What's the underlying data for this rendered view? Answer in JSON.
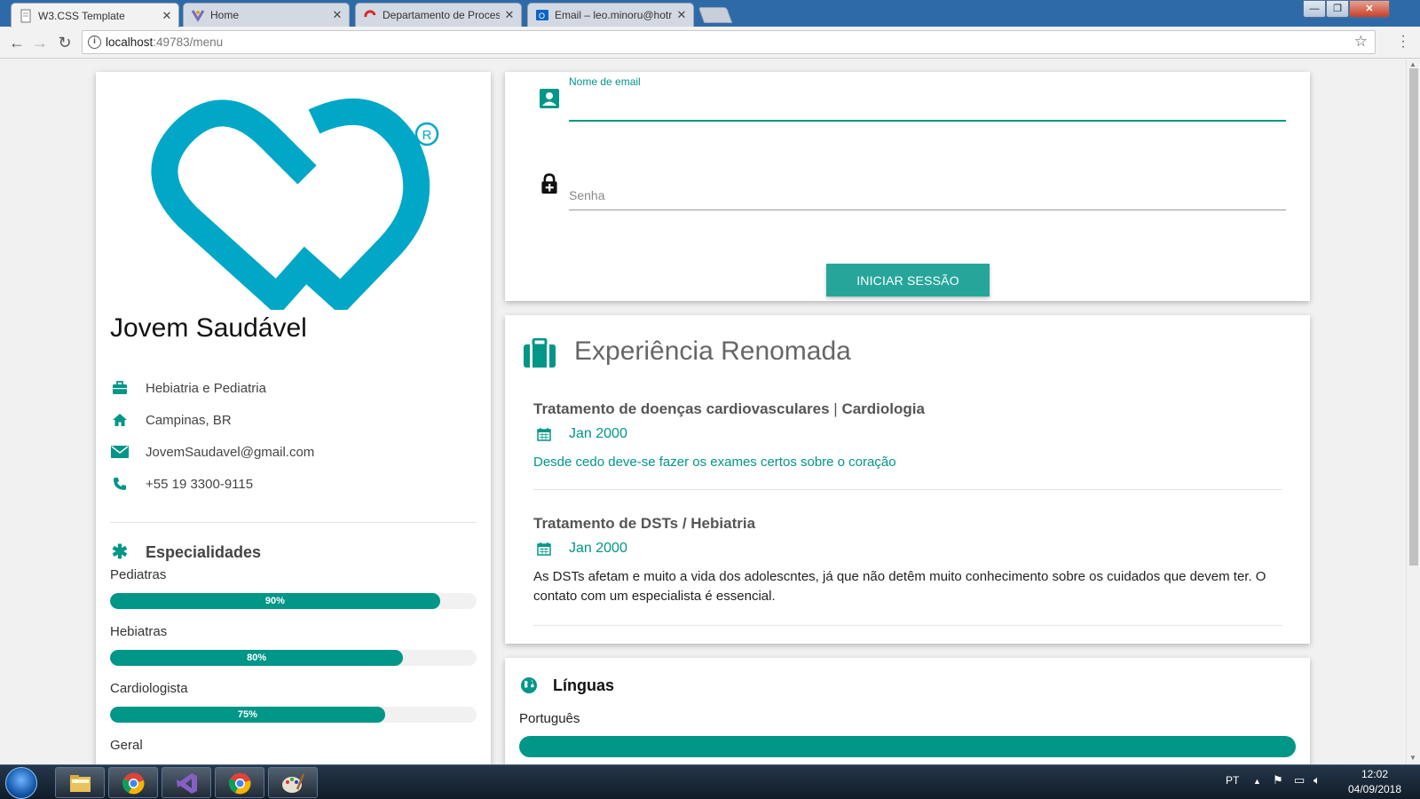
{
  "browser": {
    "tabs": [
      {
        "title": "W3.CSS Template",
        "active": true
      },
      {
        "title": "Home",
        "active": false
      },
      {
        "title": "Departamento de Proces",
        "active": false
      },
      {
        "title": "Email – leo.minoru@hotr",
        "active": false
      }
    ],
    "tab_close_glyph": "✕",
    "url_host": "localhost",
    "url_rest": ":49783/menu",
    "icons": {
      "back": "arrow-left-icon",
      "forward": "arrow-right-icon",
      "reload": "reload-icon",
      "info": "info-icon",
      "star": "star-icon",
      "menu": "kebab-menu-icon"
    }
  },
  "profile": {
    "name": "Jovem Saudável",
    "info": {
      "specialty": "Hebiatria e Pediatria",
      "location": "Campinas, BR",
      "email": "JovemSaudavel@gmail.com",
      "phone": "+55 19 3300-9115"
    },
    "skills_title": "Especialidades",
    "skills": [
      {
        "label": "Pediatras",
        "percent": 90,
        "percent_text": "90%"
      },
      {
        "label": "Hebiatras",
        "percent": 80,
        "percent_text": "80%"
      },
      {
        "label": "Cardiologista",
        "percent": 75,
        "percent_text": "75%"
      },
      {
        "label": "Geral"
      }
    ],
    "logo": {
      "name": "heart-logo",
      "registered_mark": "R",
      "color": "#00a7c7"
    }
  },
  "login": {
    "email_label": "Nome de email",
    "email_value": "",
    "password_placeholder": "Senha",
    "button_label": "INICIAR SESSÃO"
  },
  "experience": {
    "title": "Experiência Renomada",
    "jobs": [
      {
        "title_main": "Tratamento de doenças cardiovasculares",
        "title_sep": "|",
        "title_tail": "Cardiologia",
        "date": "Jan 2000",
        "description": "Desde cedo deve-se fazer os exames certos sobre o coração"
      },
      {
        "title_main": "Tratamento de DSTs / Hebiatria",
        "date": "Jan 2000",
        "description": "As DSTs afetam e muito a vida dos adolescntes, já que não detêm muito conhecimento sobre os cuidados que devem ter. O contato com um especialista é essencial."
      }
    ]
  },
  "languages": {
    "title": "Línguas",
    "items": [
      {
        "label": "Português"
      }
    ]
  },
  "taskbar": {
    "language": "PT",
    "time": "12:02",
    "date": "04/09/2018"
  },
  "colors": {
    "accent": "#009688",
    "button": "#26a69a",
    "logo": "#00a7c7"
  }
}
